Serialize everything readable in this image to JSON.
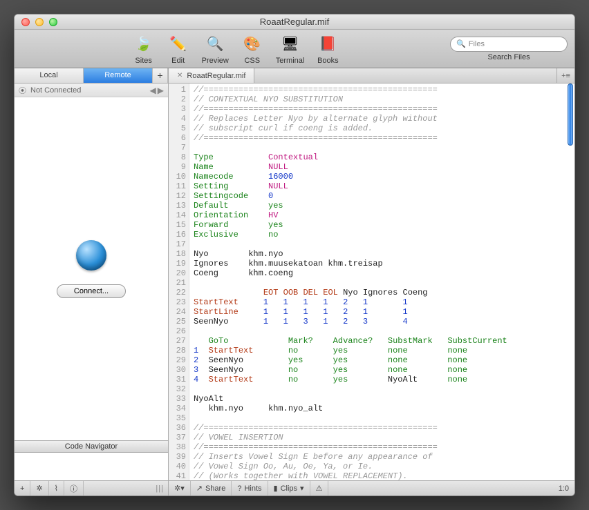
{
  "window": {
    "title": "RoaatRegular.mif"
  },
  "toolbar": {
    "items": [
      {
        "label": "Sites",
        "icon": "🍃"
      },
      {
        "label": "Edit",
        "icon": "✏️"
      },
      {
        "label": "Preview",
        "icon": "🔍"
      },
      {
        "label": "CSS",
        "icon": "🎨"
      },
      {
        "label": "Terminal",
        "icon": "🖥"
      },
      {
        "label": "Books",
        "icon": "📕"
      }
    ],
    "search_placeholder": "Files",
    "search_label": "Search Files"
  },
  "sidebar": {
    "tabs": {
      "local": "Local",
      "remote": "Remote",
      "plus": "+"
    },
    "status": "Not Connected",
    "connect": "Connect...",
    "code_nav_header": "Code Navigator"
  },
  "editor": {
    "tab_label": "RoaatRegular.mif",
    "corner": "+≡"
  },
  "code": {
    "lines": [
      {
        "n": 1,
        "html": "<span class='c-comment'>//===============================================</span>"
      },
      {
        "n": 2,
        "html": "<span class='c-comment'>// CONTEXTUAL NYO SUBSTITUTION</span>"
      },
      {
        "n": 3,
        "html": "<span class='c-comment'>//===============================================</span>"
      },
      {
        "n": 4,
        "html": "<span class='c-comment'>// Replaces Letter Nyo by alternate glyph without</span>"
      },
      {
        "n": 5,
        "html": "<span class='c-comment'>// subscript curl if coeng is added.</span>"
      },
      {
        "n": 6,
        "html": "<span class='c-comment'>//===============================================</span>"
      },
      {
        "n": 7,
        "html": ""
      },
      {
        "n": 8,
        "html": "<span class='c-keyword'>Type</span>           <span class='c-null'>Contextual</span>"
      },
      {
        "n": 9,
        "html": "<span class='c-keyword'>Name</span>           <span class='c-null'>NULL</span>"
      },
      {
        "n": 10,
        "html": "<span class='c-keyword'>Namecode</span>       <span class='c-value'>16000</span>"
      },
      {
        "n": 11,
        "html": "<span class='c-keyword'>Setting</span>        <span class='c-null'>NULL</span>"
      },
      {
        "n": 12,
        "html": "<span class='c-keyword'>Settingcode</span>    <span class='c-value'>0</span>"
      },
      {
        "n": 13,
        "html": "<span class='c-keyword'>Default</span>        <span class='c-green'>yes</span>"
      },
      {
        "n": 14,
        "html": "<span class='c-keyword'>Orientation</span>    <span class='c-hv'>HV</span>"
      },
      {
        "n": 15,
        "html": "<span class='c-keyword'>Forward</span>        <span class='c-green'>yes</span>"
      },
      {
        "n": 16,
        "html": "<span class='c-keyword'>Exclusive</span>      <span class='c-green'>no</span>"
      },
      {
        "n": 17,
        "html": ""
      },
      {
        "n": 18,
        "html": "Nyo        khm.nyo"
      },
      {
        "n": 19,
        "html": "Ignores    khm.muusekatoan khm.treisap"
      },
      {
        "n": 20,
        "html": "Coeng      khm.coeng"
      },
      {
        "n": 21,
        "html": ""
      },
      {
        "n": 22,
        "html": "              <span class='c-cmd'>EOT</span> <span class='c-cmd'>OOB</span> <span class='c-cmd'>DEL</span> <span class='c-cmd'>EOL</span> Nyo Ignores Coeng"
      },
      {
        "n": 23,
        "html": "<span class='c-cmd'>StartText</span>     <span class='c-value'>1</span>   <span class='c-value'>1</span>   <span class='c-value'>1</span>   <span class='c-value'>1</span>   <span class='c-value'>2</span>   <span class='c-value'>1</span>       <span class='c-value'>1</span>"
      },
      {
        "n": 24,
        "html": "<span class='c-cmd'>StartLine</span>     <span class='c-value'>1</span>   <span class='c-value'>1</span>   <span class='c-value'>1</span>   <span class='c-value'>1</span>   <span class='c-value'>2</span>   <span class='c-value'>1</span>       <span class='c-value'>1</span>"
      },
      {
        "n": 25,
        "html": "SeenNyo       <span class='c-value'>1</span>   <span class='c-value'>1</span>   <span class='c-value'>3</span>   <span class='c-value'>1</span>   <span class='c-value'>2</span>   <span class='c-value'>3</span>       <span class='c-value'>4</span>"
      },
      {
        "n": 26,
        "html": ""
      },
      {
        "n": 27,
        "html": "   <span class='c-green'>GoTo</span>            <span class='c-green'>Mark?</span>    <span class='c-green'>Advance?</span>   <span class='c-green'>SubstMark</span>   <span class='c-green'>SubstCurrent</span>"
      },
      {
        "n": 28,
        "html": "<span class='c-value'>1</span>  <span class='c-cmd'>StartText</span>       <span class='c-green'>no</span>       <span class='c-green'>yes</span>        <span class='c-green'>none</span>        <span class='c-green'>none</span>"
      },
      {
        "n": 29,
        "html": "<span class='c-value'>2</span>  SeenNyo         <span class='c-green'>yes</span>      <span class='c-green'>yes</span>        <span class='c-green'>none</span>        <span class='c-green'>none</span>"
      },
      {
        "n": 30,
        "html": "<span class='c-value'>3</span>  SeenNyo         <span class='c-green'>no</span>       <span class='c-green'>yes</span>        <span class='c-green'>none</span>        <span class='c-green'>none</span>"
      },
      {
        "n": 31,
        "html": "<span class='c-value'>4</span>  <span class='c-cmd'>StartText</span>       <span class='c-green'>no</span>       <span class='c-green'>yes</span>        NyoAlt      <span class='c-green'>none</span>"
      },
      {
        "n": 32,
        "html": ""
      },
      {
        "n": 33,
        "html": "NyoAlt"
      },
      {
        "n": 34,
        "html": "   khm.nyo     khm.nyo_alt"
      },
      {
        "n": 35,
        "html": ""
      },
      {
        "n": 36,
        "html": "<span class='c-comment'>//===============================================</span>"
      },
      {
        "n": 37,
        "html": "<span class='c-comment'>// VOWEL INSERTION</span>"
      },
      {
        "n": 38,
        "html": "<span class='c-comment'>//===============================================</span>"
      },
      {
        "n": 39,
        "html": "<span class='c-comment'>// Inserts Vowel Sign E before any appearance of</span>"
      },
      {
        "n": 40,
        "html": "<span class='c-comment'>// Vowel Sign Oo, Au, Oe, Ya, or Ie.</span>"
      },
      {
        "n": 41,
        "html": "<span class='c-comment'>// (Works together with VOWEL REPLACEMENT).</span>"
      }
    ]
  },
  "status": {
    "left": {
      "plus": "+",
      "gear": "✲",
      "signal": "⌇",
      "info": "ⓘ"
    },
    "right": {
      "gear": "✲▾",
      "share": "Share",
      "hints": "Hints",
      "clips": "Clips",
      "clips_arrow": "▾",
      "warn": "⚠",
      "pos": "1:0"
    }
  }
}
